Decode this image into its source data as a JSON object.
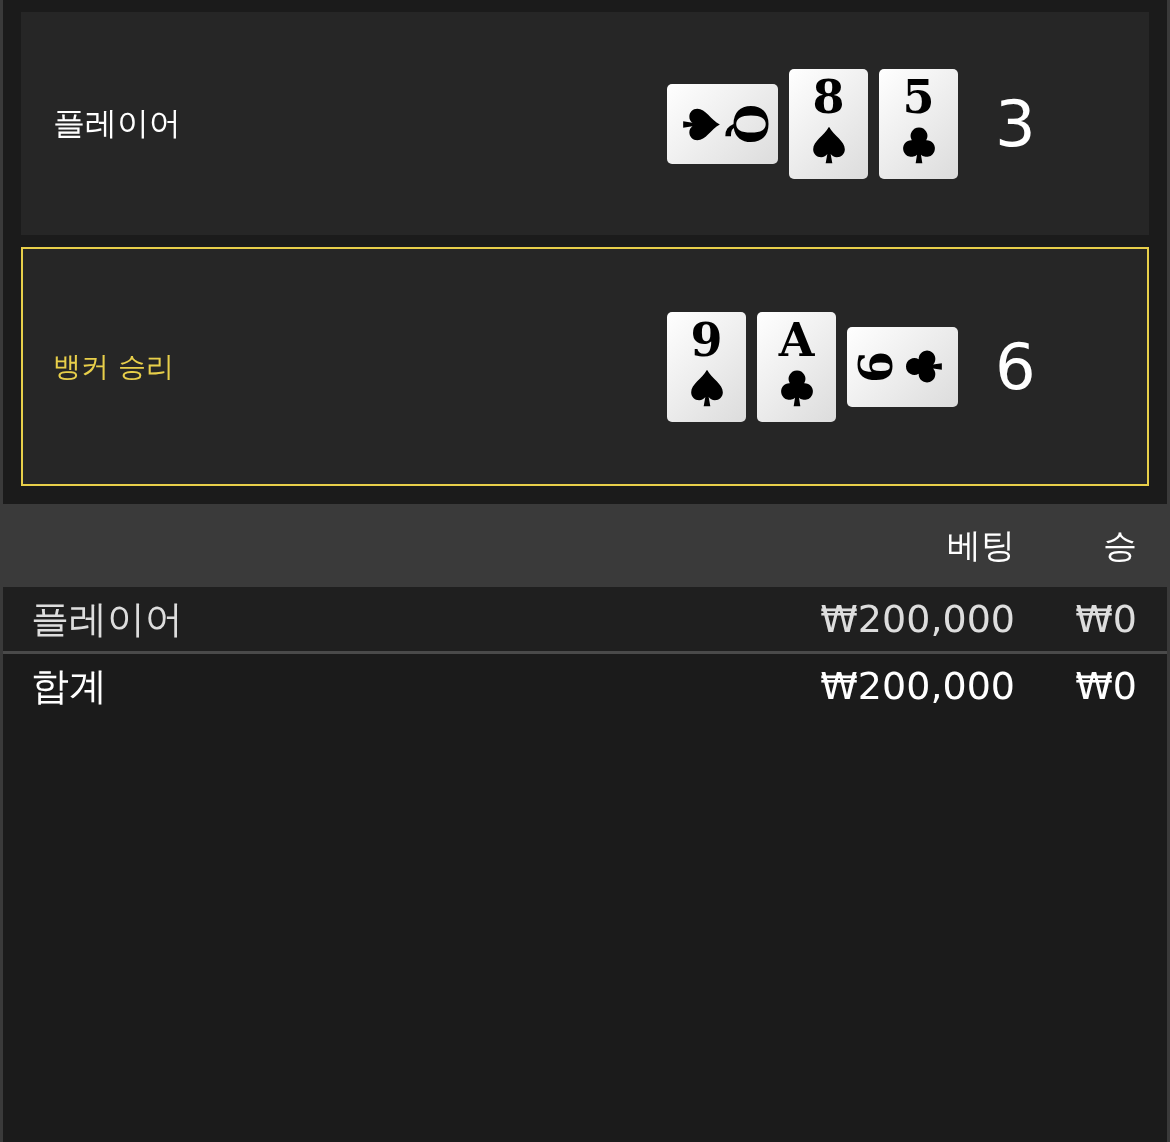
{
  "hands": [
    {
      "label": "플레이어",
      "winner": false,
      "score": "3",
      "cards": [
        {
          "rank": "Q",
          "kind": "spade",
          "turned_right": true,
          "turned_left": false
        },
        {
          "rank": "8",
          "kind": "spade",
          "turned_right": false,
          "turned_left": false
        },
        {
          "rank": "5",
          "kind": "club",
          "turned_right": false,
          "turned_left": false
        }
      ]
    },
    {
      "label": "뱅커 승리",
      "winner": true,
      "score": "6",
      "cards": [
        {
          "rank": "9",
          "kind": "spade",
          "turned_right": false,
          "turned_left": false
        },
        {
          "rank": "A",
          "kind": "club",
          "turned_right": false,
          "turned_left": false
        },
        {
          "rank": "6",
          "kind": "club",
          "turned_right": false,
          "turned_left": true
        }
      ]
    }
  ],
  "bets": {
    "columns": [
      "베팅",
      "승"
    ],
    "rows": [
      {
        "kind": "bet",
        "label": "플레이어",
        "bet": "₩200,000",
        "win": "₩0"
      },
      {
        "kind": "total",
        "label": "합계",
        "bet": "₩200,000",
        "win": "₩0"
      }
    ]
  }
}
